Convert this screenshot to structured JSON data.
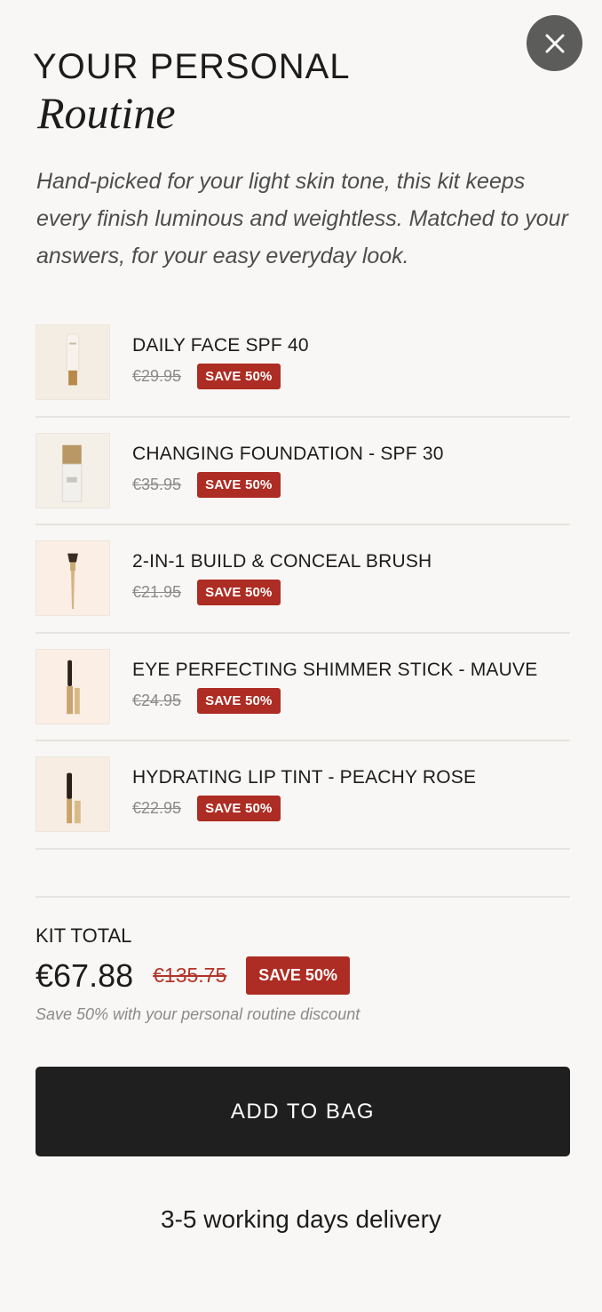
{
  "close": {
    "icon": "close-icon"
  },
  "header": {
    "title_line1": "YOUR PERSONAL",
    "title_line2": "Routine",
    "intro": "Hand-picked for your light skin tone, this kit keeps every finish luminous and weightless. Matched to your answers, for your easy everyday look."
  },
  "products": [
    {
      "name": "DAILY FACE SPF 40",
      "old_price": "€29.95",
      "badge": "SAVE 50%",
      "thumb_bg": "#f4ede3"
    },
    {
      "name": "CHANGING FOUNDATION - SPF 30",
      "old_price": "€35.95",
      "badge": "SAVE 50%",
      "thumb_bg": "#f4f0e8"
    },
    {
      "name": "2-IN-1 BUILD & CONCEAL BRUSH",
      "old_price": "€21.95",
      "badge": "SAVE 50%",
      "thumb_bg": "#fbeee4"
    },
    {
      "name": "EYE PERFECTING SHIMMER STICK - MAUVE",
      "old_price": "€24.95",
      "badge": "SAVE 50%",
      "thumb_bg": "#fbeee4"
    },
    {
      "name": "HYDRATING LIP TINT - PEACHY ROSE",
      "old_price": "€22.95",
      "badge": "SAVE 50%",
      "thumb_bg": "#f8ede2"
    }
  ],
  "kit": {
    "label": "KIT TOTAL",
    "price": "€67.88",
    "old_price": "€135.75",
    "badge": "SAVE 50%",
    "note": "Save 50% with your personal routine discount"
  },
  "cta": {
    "label": "ADD TO BAG"
  },
  "delivery": "3-5 working days delivery",
  "colors": {
    "accent": "#ad2c23",
    "button": "#1f1f1f",
    "background": "#f8f7f5"
  }
}
